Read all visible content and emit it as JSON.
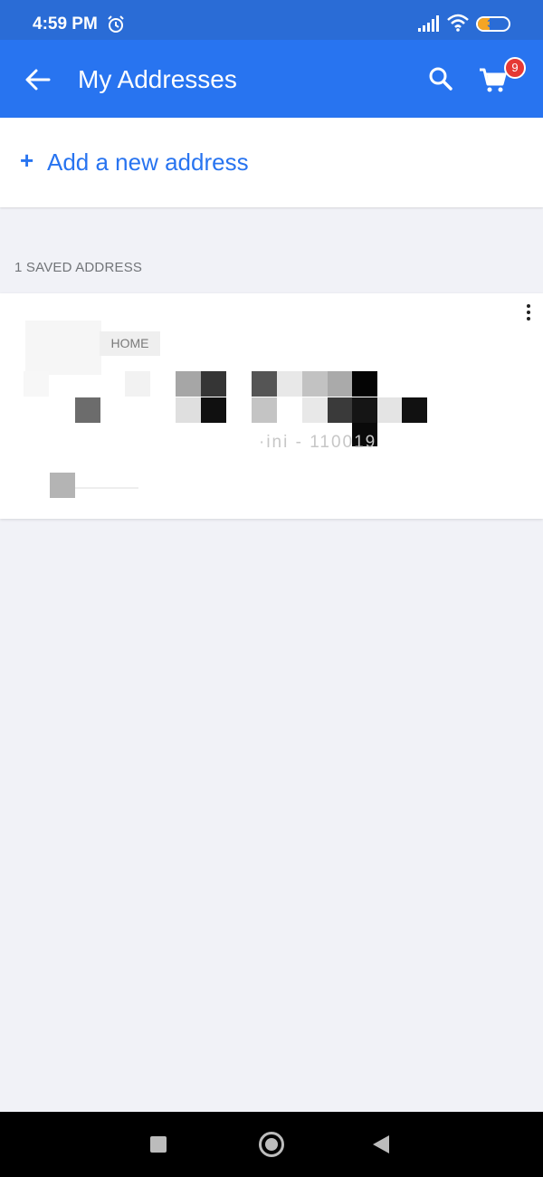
{
  "status_bar": {
    "time": "4:59 PM",
    "battery_level": "37",
    "battery_fraction": 0.37,
    "icons": [
      "alarm-icon",
      "signal-icon",
      "wifi-icon",
      "battery-icon"
    ]
  },
  "app_bar": {
    "title": "My Addresses",
    "cart_count": "9",
    "icons": [
      "back-arrow-icon",
      "search-icon",
      "cart-icon"
    ]
  },
  "add_address": {
    "plus": "+",
    "label": "Add a new address"
  },
  "saved": {
    "heading": "1 SAVED ADDRESS"
  },
  "address_card": {
    "tag": "HOME",
    "pincode_partial": "·ini - 110019"
  },
  "colors": {
    "status_bar": "#2a6cd6",
    "app_bar": "#2874f0",
    "accent": "#2874f0",
    "badge": "#e53935",
    "background": "#f1f2f7"
  }
}
